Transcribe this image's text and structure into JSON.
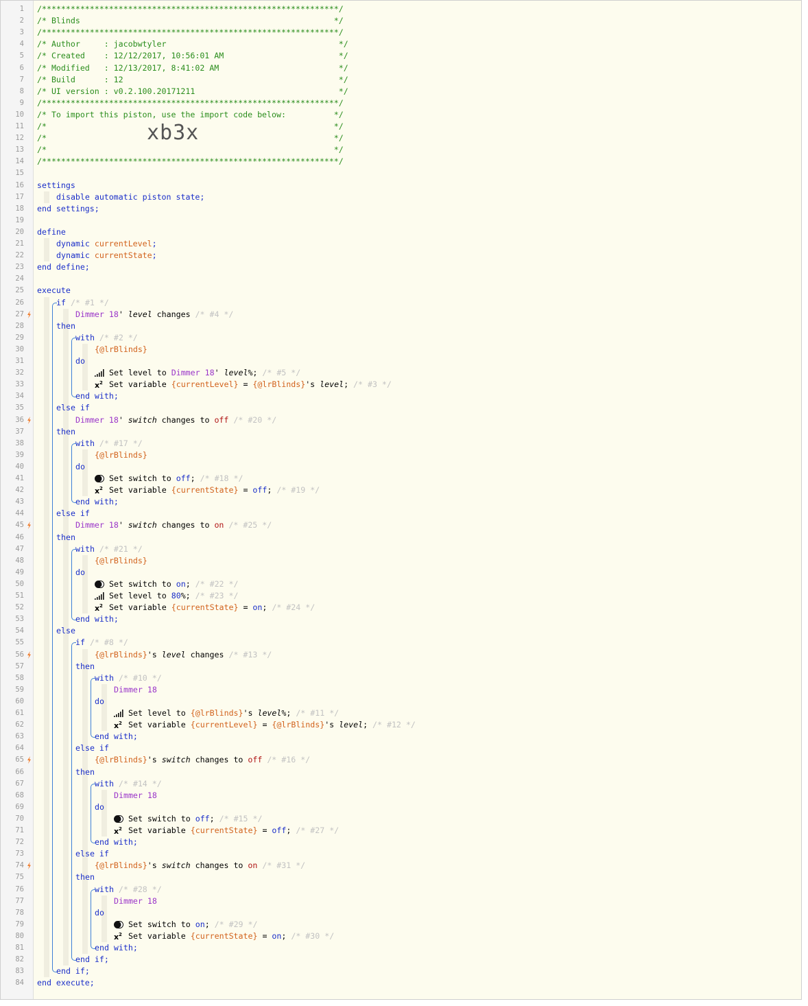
{
  "piston": {
    "name": "Blinds",
    "author": "jacobwtyler",
    "created": "12/12/2017, 10:56:01 AM",
    "modified": "12/13/2017, 8:41:02 AM",
    "build": "12",
    "ui_version": "v0.2.100.20171211",
    "import_code": "xb3x"
  },
  "colors": {
    "comment": "#2a8d1c",
    "keyword": "#1a2ec9",
    "device": "#9a35c9",
    "variable": "#d2621c",
    "bolt": "#f07a28",
    "bracket": "#3d7fd6"
  },
  "lines": [
    {
      "n": "1",
      "indent": 0,
      "t": [
        [
          "c",
          "/**************************************************************/"
        ]
      ]
    },
    {
      "n": "2",
      "indent": 0,
      "t": [
        [
          "c",
          "/* Blinds                                                     */"
        ]
      ]
    },
    {
      "n": "3",
      "indent": 0,
      "t": [
        [
          "c",
          "/**************************************************************/"
        ]
      ]
    },
    {
      "n": "4",
      "indent": 0,
      "t": [
        [
          "c",
          "/* Author     : jacobwtyler                                    */"
        ]
      ]
    },
    {
      "n": "5",
      "indent": 0,
      "t": [
        [
          "c",
          "/* Created    : 12/12/2017, 10:56:01 AM                        */"
        ]
      ]
    },
    {
      "n": "6",
      "indent": 0,
      "t": [
        [
          "c",
          "/* Modified   : 12/13/2017, 8:41:02 AM                         */"
        ]
      ]
    },
    {
      "n": "7",
      "indent": 0,
      "t": [
        [
          "c",
          "/* Build      : 12                                             */"
        ]
      ]
    },
    {
      "n": "8",
      "indent": 0,
      "t": [
        [
          "c",
          "/* UI version : v0.2.100.20171211                              */"
        ]
      ]
    },
    {
      "n": "9",
      "indent": 0,
      "t": [
        [
          "c",
          "/**************************************************************/"
        ]
      ]
    },
    {
      "n": "10",
      "indent": 0,
      "t": [
        [
          "c",
          "/* To import this piston, use the import code below:          */"
        ]
      ]
    },
    {
      "n": "11",
      "indent": 0,
      "t": [
        [
          "c",
          "/*                                                            */"
        ]
      ]
    },
    {
      "n": "12",
      "indent": 0,
      "t": [
        [
          "c",
          "/*                                                            */"
        ]
      ],
      "big": "xb3x"
    },
    {
      "n": "13",
      "indent": 0,
      "t": [
        [
          "c",
          "/*                                                            */"
        ]
      ]
    },
    {
      "n": "14",
      "indent": 0,
      "t": [
        [
          "c",
          "/**************************************************************/"
        ]
      ]
    },
    {
      "n": "15",
      "indent": 0,
      "t": []
    },
    {
      "n": "16",
      "indent": 0,
      "t": [
        [
          "kw",
          "settings"
        ]
      ]
    },
    {
      "n": "17",
      "indent": 1,
      "t": [
        [
          "kw",
          "disable automatic piston state;"
        ]
      ]
    },
    {
      "n": "18",
      "indent": 0,
      "t": [
        [
          "kw",
          "end settings;"
        ]
      ]
    },
    {
      "n": "19",
      "indent": 0,
      "t": []
    },
    {
      "n": "20",
      "indent": 0,
      "t": [
        [
          "kw",
          "define"
        ]
      ]
    },
    {
      "n": "21",
      "indent": 1,
      "t": [
        [
          "kw",
          "dynamic "
        ],
        [
          "var",
          "currentLevel"
        ],
        [
          "kw",
          ";"
        ]
      ]
    },
    {
      "n": "22",
      "indent": 1,
      "t": [
        [
          "kw",
          "dynamic "
        ],
        [
          "var",
          "currentState"
        ],
        [
          "kw",
          ";"
        ]
      ]
    },
    {
      "n": "23",
      "indent": 0,
      "t": [
        [
          "kw",
          "end define;"
        ]
      ]
    },
    {
      "n": "24",
      "indent": 0,
      "t": []
    },
    {
      "n": "25",
      "indent": 0,
      "t": [
        [
          "kw",
          "execute"
        ]
      ]
    },
    {
      "n": "26",
      "indent": 1,
      "off": 1,
      "t": [
        [
          "kw",
          "if "
        ],
        [
          "com",
          "/* #1 */"
        ]
      ]
    },
    {
      "n": "27",
      "indent": 2,
      "bolt": true,
      "t": [
        [
          "dev",
          "Dimmer 18"
        ],
        [
          "plain",
          "' "
        ],
        [
          "it",
          "level"
        ],
        [
          "plain",
          " changes "
        ],
        [
          "com",
          "/* #4 */"
        ]
      ]
    },
    {
      "n": "28",
      "indent": 1,
      "off": 1,
      "t": [
        [
          "kw",
          "then"
        ]
      ]
    },
    {
      "n": "29",
      "indent": 2,
      "off": 2,
      "t": [
        [
          "kw",
          "with "
        ],
        [
          "com",
          "/* #2 */"
        ]
      ]
    },
    {
      "n": "30",
      "indent": 3,
      "t": [
        [
          "var",
          "{@lrBlinds}"
        ]
      ]
    },
    {
      "n": "31",
      "indent": 2,
      "off": 2,
      "t": [
        [
          "kw",
          "do"
        ]
      ]
    },
    {
      "n": "32",
      "indent": 3,
      "icon": "level",
      "t": [
        [
          "plain",
          "Set level to "
        ],
        [
          "dev",
          "Dimmer 18"
        ],
        [
          "plain",
          "' "
        ],
        [
          "it",
          "level"
        ],
        [
          "plain",
          "%; "
        ],
        [
          "com",
          "/* #5 */"
        ]
      ]
    },
    {
      "n": "33",
      "indent": 3,
      "icon": "x2",
      "t": [
        [
          "plain",
          "Set variable "
        ],
        [
          "var",
          "{currentLevel}"
        ],
        [
          "plain",
          " = "
        ],
        [
          "var",
          "{@lrBlinds}"
        ],
        [
          "plain",
          "'s "
        ],
        [
          "it",
          "level"
        ],
        [
          "plain",
          "; "
        ],
        [
          "com",
          "/* #3 */"
        ]
      ]
    },
    {
      "n": "34",
      "indent": 2,
      "off": 2,
      "t": [
        [
          "kw",
          "end with;"
        ]
      ]
    },
    {
      "n": "35",
      "indent": 1,
      "off": 1,
      "t": [
        [
          "kw",
          "else if"
        ]
      ]
    },
    {
      "n": "36",
      "indent": 2,
      "bolt": true,
      "t": [
        [
          "dev",
          "Dimmer 18"
        ],
        [
          "plain",
          "' "
        ],
        [
          "it",
          "switch"
        ],
        [
          "plain",
          " changes to "
        ],
        [
          "on",
          "off"
        ],
        [
          "plain",
          " "
        ],
        [
          "com",
          "/* #20 */"
        ]
      ]
    },
    {
      "n": "37",
      "indent": 1,
      "off": 1,
      "t": [
        [
          "kw",
          "then"
        ]
      ]
    },
    {
      "n": "38",
      "indent": 2,
      "off": 2,
      "t": [
        [
          "kw",
          "with "
        ],
        [
          "com",
          "/* #17 */"
        ]
      ]
    },
    {
      "n": "39",
      "indent": 3,
      "t": [
        [
          "var",
          "{@lrBlinds}"
        ]
      ]
    },
    {
      "n": "40",
      "indent": 2,
      "off": 2,
      "t": [
        [
          "kw",
          "do"
        ]
      ]
    },
    {
      "n": "41",
      "indent": 3,
      "icon": "toggle",
      "t": [
        [
          "plain",
          "Set switch to "
        ],
        [
          "val",
          "off"
        ],
        [
          "plain",
          "; "
        ],
        [
          "com",
          "/* #18 */"
        ]
      ]
    },
    {
      "n": "42",
      "indent": 3,
      "icon": "x2",
      "t": [
        [
          "plain",
          "Set variable "
        ],
        [
          "var",
          "{currentState}"
        ],
        [
          "plain",
          " = "
        ],
        [
          "val",
          "off"
        ],
        [
          "plain",
          "; "
        ],
        [
          "com",
          "/* #19 */"
        ]
      ]
    },
    {
      "n": "43",
      "indent": 2,
      "off": 2,
      "t": [
        [
          "kw",
          "end with;"
        ]
      ]
    },
    {
      "n": "44",
      "indent": 1,
      "off": 1,
      "t": [
        [
          "kw",
          "else if"
        ]
      ]
    },
    {
      "n": "45",
      "indent": 2,
      "bolt": true,
      "t": [
        [
          "dev",
          "Dimmer 18"
        ],
        [
          "plain",
          "' "
        ],
        [
          "it",
          "switch"
        ],
        [
          "plain",
          " changes to "
        ],
        [
          "on",
          "on"
        ],
        [
          "plain",
          " "
        ],
        [
          "com",
          "/* #25 */"
        ]
      ]
    },
    {
      "n": "46",
      "indent": 1,
      "off": 1,
      "t": [
        [
          "kw",
          "then"
        ]
      ]
    },
    {
      "n": "47",
      "indent": 2,
      "off": 2,
      "t": [
        [
          "kw",
          "with "
        ],
        [
          "com",
          "/* #21 */"
        ]
      ]
    },
    {
      "n": "48",
      "indent": 3,
      "t": [
        [
          "var",
          "{@lrBlinds}"
        ]
      ]
    },
    {
      "n": "49",
      "indent": 2,
      "off": 2,
      "t": [
        [
          "kw",
          "do"
        ]
      ]
    },
    {
      "n": "50",
      "indent": 3,
      "icon": "toggle",
      "t": [
        [
          "plain",
          "Set switch to "
        ],
        [
          "val",
          "on"
        ],
        [
          "plain",
          "; "
        ],
        [
          "com",
          "/* #22 */"
        ]
      ]
    },
    {
      "n": "51",
      "indent": 3,
      "icon": "level",
      "t": [
        [
          "plain",
          "Set level to "
        ],
        [
          "num",
          "80"
        ],
        [
          "plain",
          "%; "
        ],
        [
          "com",
          "/* #23 */"
        ]
      ]
    },
    {
      "n": "52",
      "indent": 3,
      "icon": "x2",
      "t": [
        [
          "plain",
          "Set variable "
        ],
        [
          "var",
          "{currentState}"
        ],
        [
          "plain",
          " = "
        ],
        [
          "val",
          "on"
        ],
        [
          "plain",
          "; "
        ],
        [
          "com",
          "/* #24 */"
        ]
      ]
    },
    {
      "n": "53",
      "indent": 2,
      "off": 2,
      "t": [
        [
          "kw",
          "end with;"
        ]
      ]
    },
    {
      "n": "54",
      "indent": 1,
      "off": 1,
      "t": [
        [
          "kw",
          "else"
        ]
      ]
    },
    {
      "n": "55",
      "indent": 2,
      "off": 2,
      "t": [
        [
          "kw",
          "if "
        ],
        [
          "com",
          "/* #8 */"
        ]
      ]
    },
    {
      "n": "56",
      "indent": 3,
      "bolt": true,
      "t": [
        [
          "var",
          "{@lrBlinds}"
        ],
        [
          "plain",
          "'s "
        ],
        [
          "it",
          "level"
        ],
        [
          "plain",
          " changes "
        ],
        [
          "com",
          "/* #13 */"
        ]
      ]
    },
    {
      "n": "57",
      "indent": 2,
      "off": 2,
      "t": [
        [
          "kw",
          "then"
        ]
      ]
    },
    {
      "n": "58",
      "indent": 3,
      "off": 3,
      "t": [
        [
          "kw",
          "with "
        ],
        [
          "com",
          "/* #10 */"
        ]
      ]
    },
    {
      "n": "59",
      "indent": 4,
      "t": [
        [
          "dev",
          "Dimmer 18"
        ]
      ]
    },
    {
      "n": "60",
      "indent": 3,
      "off": 3,
      "t": [
        [
          "kw",
          "do"
        ]
      ]
    },
    {
      "n": "61",
      "indent": 4,
      "icon": "level",
      "t": [
        [
          "plain",
          "Set level to "
        ],
        [
          "var",
          "{@lrBlinds}"
        ],
        [
          "plain",
          "'s "
        ],
        [
          "it",
          "level"
        ],
        [
          "plain",
          "%; "
        ],
        [
          "com",
          "/* #11 */"
        ]
      ]
    },
    {
      "n": "62",
      "indent": 4,
      "icon": "x2",
      "t": [
        [
          "plain",
          "Set variable "
        ],
        [
          "var",
          "{currentLevel}"
        ],
        [
          "plain",
          " = "
        ],
        [
          "var",
          "{@lrBlinds}"
        ],
        [
          "plain",
          "'s "
        ],
        [
          "it",
          "level"
        ],
        [
          "plain",
          "; "
        ],
        [
          "com",
          "/* #12 */"
        ]
      ]
    },
    {
      "n": "63",
      "indent": 3,
      "off": 3,
      "t": [
        [
          "kw",
          "end with;"
        ]
      ]
    },
    {
      "n": "64",
      "indent": 2,
      "off": 2,
      "t": [
        [
          "kw",
          "else if"
        ]
      ]
    },
    {
      "n": "65",
      "indent": 3,
      "bolt": true,
      "t": [
        [
          "var",
          "{@lrBlinds}"
        ],
        [
          "plain",
          "'s "
        ],
        [
          "it",
          "switch"
        ],
        [
          "plain",
          " changes to "
        ],
        [
          "on",
          "off"
        ],
        [
          "plain",
          " "
        ],
        [
          "com",
          "/* #16 */"
        ]
      ]
    },
    {
      "n": "66",
      "indent": 2,
      "off": 2,
      "t": [
        [
          "kw",
          "then"
        ]
      ]
    },
    {
      "n": "67",
      "indent": 3,
      "off": 3,
      "t": [
        [
          "kw",
          "with "
        ],
        [
          "com",
          "/* #14 */"
        ]
      ]
    },
    {
      "n": "68",
      "indent": 4,
      "t": [
        [
          "dev",
          "Dimmer 18"
        ]
      ]
    },
    {
      "n": "69",
      "indent": 3,
      "off": 3,
      "t": [
        [
          "kw",
          "do"
        ]
      ]
    },
    {
      "n": "70",
      "indent": 4,
      "icon": "toggle",
      "t": [
        [
          "plain",
          "Set switch to "
        ],
        [
          "val",
          "off"
        ],
        [
          "plain",
          "; "
        ],
        [
          "com",
          "/* #15 */"
        ]
      ]
    },
    {
      "n": "71",
      "indent": 4,
      "icon": "x2",
      "t": [
        [
          "plain",
          "Set variable "
        ],
        [
          "var",
          "{currentState}"
        ],
        [
          "plain",
          " = "
        ],
        [
          "val",
          "off"
        ],
        [
          "plain",
          "; "
        ],
        [
          "com",
          "/* #27 */"
        ]
      ]
    },
    {
      "n": "72",
      "indent": 3,
      "off": 3,
      "t": [
        [
          "kw",
          "end with;"
        ]
      ]
    },
    {
      "n": "73",
      "indent": 2,
      "off": 2,
      "t": [
        [
          "kw",
          "else if"
        ]
      ]
    },
    {
      "n": "74",
      "indent": 3,
      "bolt": true,
      "t": [
        [
          "var",
          "{@lrBlinds}"
        ],
        [
          "plain",
          "'s "
        ],
        [
          "it",
          "switch"
        ],
        [
          "plain",
          " changes to "
        ],
        [
          "on",
          "on"
        ],
        [
          "plain",
          " "
        ],
        [
          "com",
          "/* #31 */"
        ]
      ]
    },
    {
      "n": "75",
      "indent": 2,
      "off": 2,
      "t": [
        [
          "kw",
          "then"
        ]
      ]
    },
    {
      "n": "76",
      "indent": 3,
      "off": 3,
      "t": [
        [
          "kw",
          "with "
        ],
        [
          "com",
          "/* #28 */"
        ]
      ]
    },
    {
      "n": "77",
      "indent": 4,
      "t": [
        [
          "dev",
          "Dimmer 18"
        ]
      ]
    },
    {
      "n": "78",
      "indent": 3,
      "off": 3,
      "t": [
        [
          "kw",
          "do"
        ]
      ]
    },
    {
      "n": "79",
      "indent": 4,
      "icon": "toggle",
      "t": [
        [
          "plain",
          "Set switch to "
        ],
        [
          "val",
          "on"
        ],
        [
          "plain",
          "; "
        ],
        [
          "com",
          "/* #29 */"
        ]
      ]
    },
    {
      "n": "80",
      "indent": 4,
      "icon": "x2",
      "t": [
        [
          "plain",
          "Set variable "
        ],
        [
          "var",
          "{currentState}"
        ],
        [
          "plain",
          " = "
        ],
        [
          "val",
          "on"
        ],
        [
          "plain",
          "; "
        ],
        [
          "com",
          "/* #30 */"
        ]
      ]
    },
    {
      "n": "81",
      "indent": 3,
      "off": 3,
      "t": [
        [
          "kw",
          "end with;"
        ]
      ]
    },
    {
      "n": "82",
      "indent": 2,
      "off": 2,
      "t": [
        [
          "kw",
          "end if;"
        ]
      ]
    },
    {
      "n": "83",
      "indent": 1,
      "off": 1,
      "t": [
        [
          "kw",
          "end if;"
        ]
      ]
    },
    {
      "n": "84",
      "indent": 0,
      "t": [
        [
          "kw",
          "end execute;"
        ]
      ]
    }
  ]
}
